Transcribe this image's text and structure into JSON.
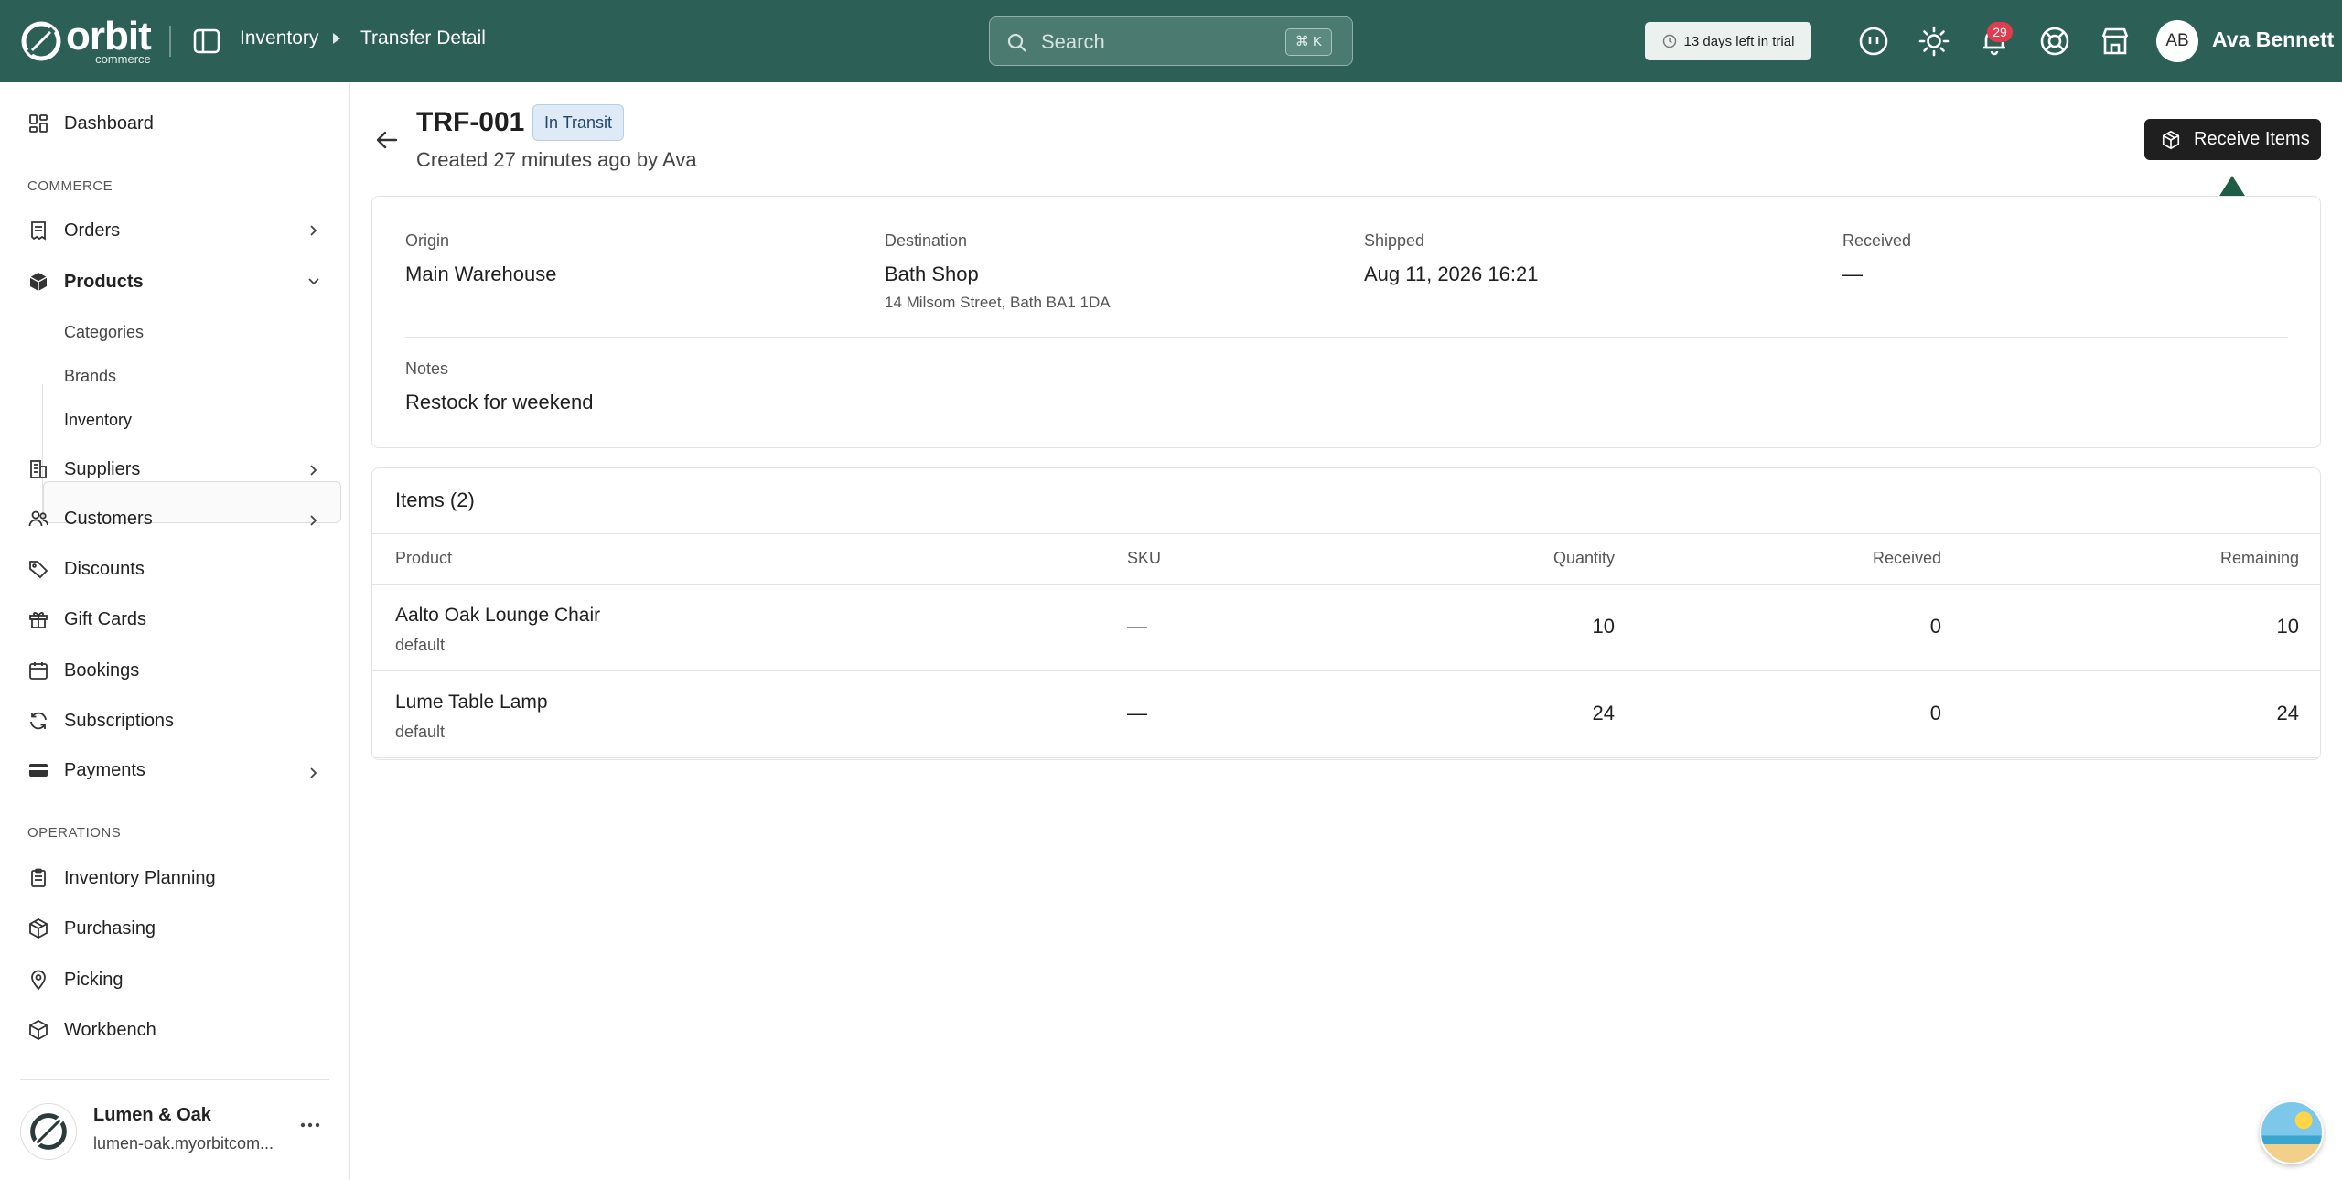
{
  "brand": {
    "name": "orbit",
    "sub": "commerce"
  },
  "breadcrumb": {
    "items": [
      "Inventory",
      "Transfer Detail"
    ]
  },
  "search": {
    "placeholder": "Search",
    "shortcut": "⌘ K"
  },
  "trial": {
    "label": "13 days left in trial"
  },
  "notifications": {
    "count": "29"
  },
  "user": {
    "initials": "AB",
    "name": "Ava Bennett"
  },
  "sidebar": {
    "dashboard": "Dashboard",
    "section_commerce": "COMMERCE",
    "orders": "Orders",
    "products": "Products",
    "product_sub": [
      "Categories",
      "Brands",
      "Inventory"
    ],
    "suppliers": "Suppliers",
    "customers": "Customers",
    "discounts": "Discounts",
    "gift_cards": "Gift Cards",
    "bookings": "Bookings",
    "subscriptions": "Subscriptions",
    "payments": "Payments",
    "section_operations": "OPERATIONS",
    "inventory_planning": "Inventory Planning",
    "purchasing": "Purchasing",
    "picking": "Picking",
    "workbench": "Workbench"
  },
  "store": {
    "name": "Lumen & Oak",
    "url": "lumen-oak.myorbitcom..."
  },
  "transfer": {
    "id": "TRF-001",
    "status": "In Transit",
    "created": "Created 27 minutes ago by Ava",
    "receive_label": "Receive Items",
    "origin_label": "Origin",
    "origin": "Main Warehouse",
    "destination_label": "Destination",
    "destination": "Bath Shop",
    "destination_address": "14 Milsom Street, Bath BA1 1DA",
    "shipped_label": "Shipped",
    "shipped": "Aug 11, 2026 16:21",
    "received_label": "Received",
    "received": "—",
    "notes_label": "Notes",
    "notes": "Restock for weekend"
  },
  "items": {
    "title": "Items (2)",
    "columns": [
      "Product",
      "SKU",
      "Quantity",
      "Received",
      "Remaining"
    ],
    "rows": [
      {
        "name": "Aalto Oak Lounge Chair",
        "variant": "default",
        "sku": "—",
        "quantity": "10",
        "received": "0",
        "remaining": "10"
      },
      {
        "name": "Lume Table Lamp",
        "variant": "default",
        "sku": "—",
        "quantity": "24",
        "received": "0",
        "remaining": "24"
      }
    ]
  },
  "colors": {
    "topbar": "#2c5f55",
    "accent_arrow": "#1e5c45",
    "badge": "#e23b4e",
    "status_bg": "#deeaf5"
  }
}
